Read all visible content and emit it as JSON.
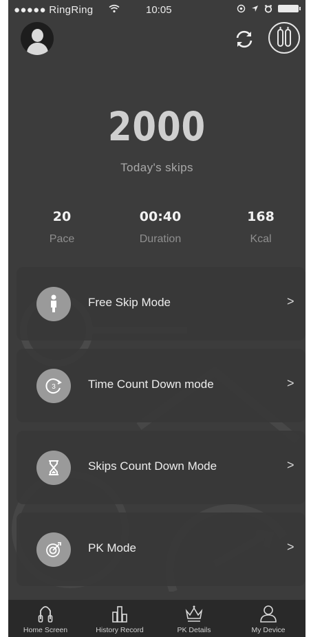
{
  "status_bar": {
    "carrier": "●●●●● RingRing",
    "time": "10:05"
  },
  "summary": {
    "total_skips": "2000",
    "total_label": "Today's skips"
  },
  "stats": [
    {
      "value": "20",
      "label": "Pace"
    },
    {
      "value": "00:40",
      "label": "Duration"
    },
    {
      "value": "168",
      "label": "Kcal"
    }
  ],
  "modes": [
    {
      "label": "Free Skip Mode",
      "icon": "person-icon"
    },
    {
      "label": "Time Count Down mode",
      "icon": "timer-icon"
    },
    {
      "label": "Skips Count Down Mode",
      "icon": "hourglass-icon"
    },
    {
      "label": "PK Mode",
      "icon": "target-icon"
    }
  ],
  "chevron": ">",
  "tabs": [
    {
      "label": "Home Screen",
      "icon": "jump-rope-icon"
    },
    {
      "label": "History Record",
      "icon": "bar-chart-icon"
    },
    {
      "label": "PK Details",
      "icon": "crown-icon"
    },
    {
      "label": "My Device",
      "icon": "user-icon"
    }
  ],
  "colors": {
    "background": "#3c3c3c",
    "card": "#383838",
    "tab_bar": "#292929",
    "text_primary": "#f2f2f2",
    "text_muted": "#8f8f8f"
  }
}
